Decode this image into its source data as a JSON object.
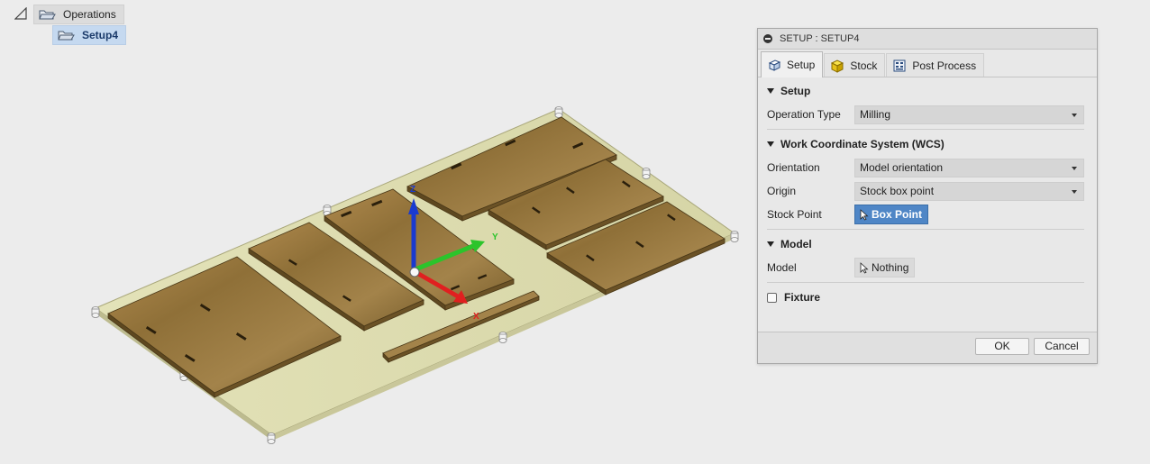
{
  "browser": {
    "operations_label": "Operations",
    "setup_label": "Setup4"
  },
  "viewport": {
    "axis_labels": {
      "x": "X",
      "y": "Y",
      "z": "Z"
    },
    "colors": {
      "x_axis": "#e02020",
      "y_axis": "#2bc42b",
      "z_axis": "#1a3ad0",
      "stock": "#dedcb0",
      "wood": "#9a7b44"
    }
  },
  "dialog": {
    "title": "SETUP : SETUP4",
    "tabs": [
      {
        "label": "Setup",
        "icon": "setup-icon",
        "active": true
      },
      {
        "label": "Stock",
        "icon": "stock-cube-icon",
        "active": false
      },
      {
        "label": "Post Process",
        "icon": "post-process-icon",
        "active": false
      }
    ],
    "sections": {
      "setup": {
        "header": "Setup",
        "operation_type_label": "Operation Type",
        "operation_type_value": "Milling"
      },
      "wcs": {
        "header": "Work Coordinate System (WCS)",
        "orientation_label": "Orientation",
        "orientation_value": "Model orientation",
        "origin_label": "Origin",
        "origin_value": "Stock box point",
        "stock_point_label": "Stock Point",
        "stock_point_value": "Box Point"
      },
      "model": {
        "header": "Model",
        "model_label": "Model",
        "model_value": "Nothing"
      },
      "fixture": {
        "label": "Fixture",
        "checked": false
      }
    },
    "ok_label": "OK",
    "cancel_label": "Cancel",
    "accent": "#4f86c6"
  }
}
